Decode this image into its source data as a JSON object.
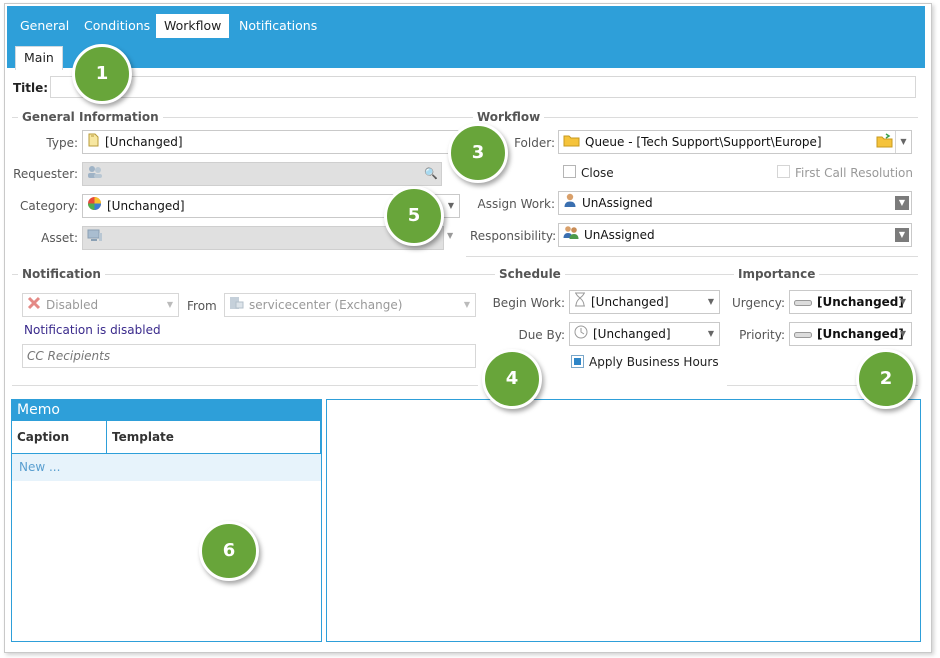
{
  "tabs": [
    {
      "label": "General",
      "active": false
    },
    {
      "label": "Conditions",
      "active": false
    },
    {
      "label": "Workflow",
      "active": true
    },
    {
      "label": "Notifications",
      "active": false
    }
  ],
  "subtab": "Main",
  "title_label": "Title:",
  "title_value": "",
  "general": {
    "heading": "General Information",
    "type_label": "Type:",
    "type_value": "[Unchanged]",
    "requester_label": "Requester:",
    "category_label": "Category:",
    "category_value": "[Unchanged]",
    "asset_label": "Asset:"
  },
  "workflow": {
    "heading": "Workflow",
    "folder_label": "Folder:",
    "folder_value": "Queue - [Tech Support\\Support\\Europe]",
    "close_label": "Close",
    "first_call_label": "First Call Resolution",
    "assign_label": "Assign Work:",
    "assign_value": "UnAssigned",
    "responsibility_label": "Responsibility:",
    "responsibility_value": "UnAssigned"
  },
  "notification": {
    "heading": "Notification",
    "disabled_value": "Disabled",
    "from_label": "From",
    "from_value": "servicecenter (Exchange)",
    "status_text": "Notification is disabled",
    "cc_placeholder": "CC Recipients"
  },
  "schedule": {
    "heading": "Schedule",
    "begin_label": "Begin Work:",
    "begin_value": "[Unchanged]",
    "due_label": "Due By:",
    "due_value": "[Unchanged]",
    "business_hours_label": "Apply Business Hours"
  },
  "importance": {
    "heading": "Importance",
    "urgency_label": "Urgency:",
    "urgency_value": "[Unchanged]",
    "priority_label": "Priority:",
    "priority_value": "[Unchanged]"
  },
  "memo": {
    "heading": "Memo",
    "col_caption": "Caption",
    "col_template": "Template",
    "new_row": "New ..."
  },
  "callouts": [
    "1",
    "2",
    "3",
    "4",
    "5",
    "6"
  ],
  "colors": {
    "accent": "#2e9fd9",
    "callout": "#68a53a"
  }
}
